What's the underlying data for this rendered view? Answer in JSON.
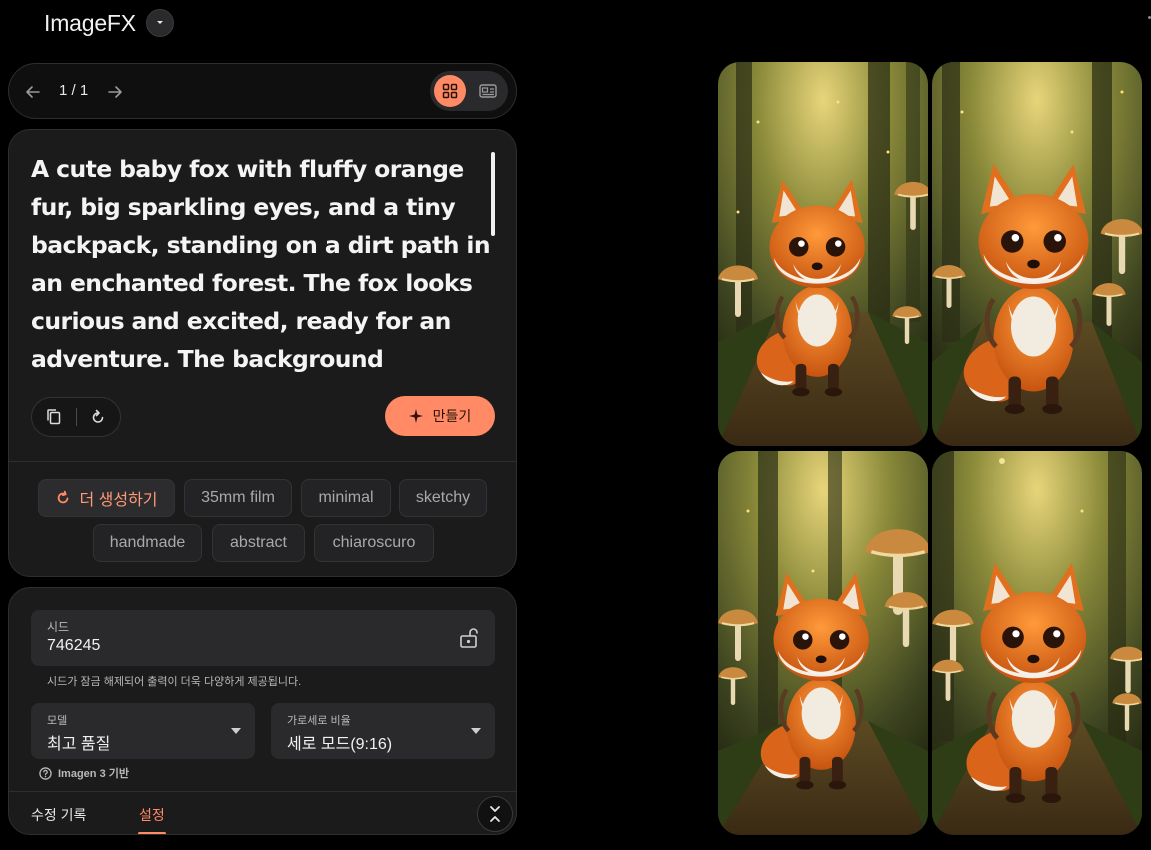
{
  "app": {
    "title": "ImageFX"
  },
  "icons": {
    "title_dropdown": "chevron-down-icon",
    "prev": "arrow-left-icon",
    "next": "arrow-right-icon",
    "grid_view": "grid-icon",
    "single_view": "single-image-icon",
    "copy": "copy-icon",
    "reset": "refresh-icon",
    "create": "sparkle-icon",
    "more": "refresh-icon",
    "lock": "unlock-icon",
    "help": "help-circle-icon",
    "collapse": "collapse-icon"
  },
  "pager": {
    "count": "1 / 1"
  },
  "prompt": {
    "text": "A cute baby fox with fluffy orange fur, big sparkling eyes, and a tiny backpack, standing on a dirt path in an enchanted forest. The fox looks curious and excited, ready for an adventure. The background features"
  },
  "actions": {
    "create_label": "만들기"
  },
  "chips": {
    "generate_more": "더 생성하기",
    "items": [
      "35mm film",
      "minimal",
      "sketchy",
      "handmade",
      "abstract",
      "chiaroscuro"
    ]
  },
  "settings": {
    "seed_label": "시드",
    "seed_value": "746245",
    "seed_help": "시드가 잠금 해제되어 출력이 더욱 다양하게 제공됩니다.",
    "model_label": "모델",
    "model_value": "최고 품질",
    "ratio_label": "가로세로 비율",
    "ratio_value": "세로 모드(9:16)",
    "imagen_note": "Imagen 3 기반"
  },
  "tabs": {
    "history": "수정 기록",
    "settings": "설정",
    "active": "settings"
  },
  "colors": {
    "accent": "#ff8a65",
    "panel": "#1b1b1c",
    "field": "#2a2a2c",
    "background": "#000000"
  },
  "images": [
    {
      "id": "fox-1",
      "subject": "baby fox with backpack in forest"
    },
    {
      "id": "fox-2",
      "subject": "baby fox with backpack in forest"
    },
    {
      "id": "fox-3",
      "subject": "baby fox with backpack in forest"
    },
    {
      "id": "fox-4",
      "subject": "baby fox with backpack in forest"
    }
  ]
}
